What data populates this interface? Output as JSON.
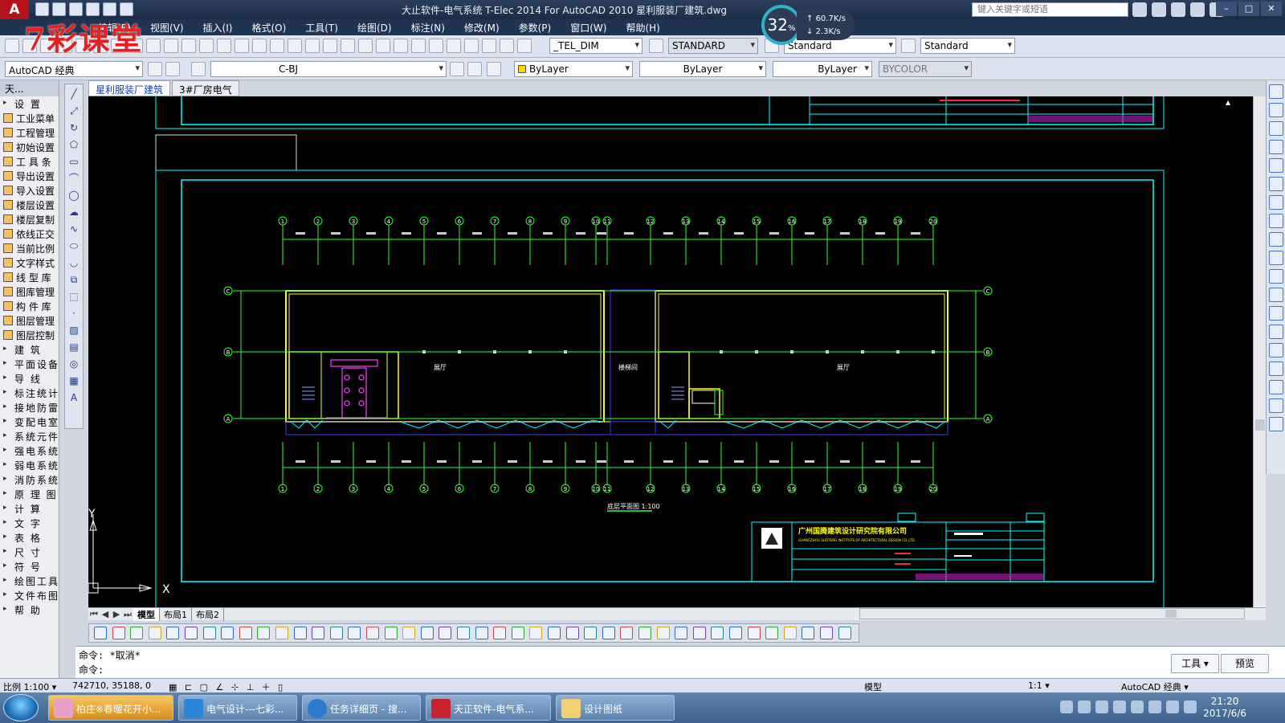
{
  "title_bar": {
    "title": "大止软件-电气系统 T-Elec 2014  For AutoCAD 2010    星利服装厂建筑.dwg",
    "search_placeholder": "键入关键字或短语",
    "app_logo": "A"
  },
  "watermark": "7彩课堂",
  "net_speed": {
    "percent": "32",
    "unit": "%",
    "up": "60.7K/s",
    "down": "2.3K/s"
  },
  "menu": [
    "编辑(E)",
    "视图(V)",
    "插入(I)",
    "格式(O)",
    "工具(T)",
    "绘图(D)",
    "标注(N)",
    "修改(M)",
    "参数(P)",
    "窗口(W)",
    "帮助(H)"
  ],
  "toolbar1": {
    "dim_style": "_TEL_DIM",
    "text_style": "STANDARD",
    "table_style": "Standard",
    "multileader_style": "Standard"
  },
  "toolbar2": {
    "workspace": "AutoCAD 经典",
    "layer": "C-BJ",
    "color": "ByLayer",
    "linetype": "ByLayer",
    "lineweight": "ByLayer",
    "plotstyle": "BYCOLOR"
  },
  "left_panel": {
    "title": "天...",
    "items": [
      {
        "label": "设    置",
        "section": true
      },
      {
        "label": "工业菜单",
        "section": false
      },
      {
        "label": "工程管理",
        "section": false
      },
      {
        "label": "初始设置",
        "section": false
      },
      {
        "label": "工 具 条",
        "section": false
      },
      {
        "label": "导出设置",
        "section": false
      },
      {
        "label": "导入设置",
        "section": false
      },
      {
        "label": "楼层设置",
        "section": false
      },
      {
        "label": "楼层复制",
        "section": false
      },
      {
        "label": "依线正交",
        "section": false
      },
      {
        "label": "当前比例",
        "section": false
      },
      {
        "label": "文字样式",
        "section": false
      },
      {
        "label": "线 型 库",
        "section": false
      },
      {
        "label": "图库管理",
        "section": false
      },
      {
        "label": "构 件 库",
        "section": false
      },
      {
        "label": "图层管理",
        "section": false
      },
      {
        "label": "图层控制",
        "section": false
      },
      {
        "label": "建    筑",
        "section": true
      },
      {
        "label": "平面设备",
        "section": true
      },
      {
        "label": "导    线",
        "section": true
      },
      {
        "label": "标注统计",
        "section": true
      },
      {
        "label": "接地防雷",
        "section": true
      },
      {
        "label": "变配电室",
        "section": true
      },
      {
        "label": "系统元件",
        "section": true
      },
      {
        "label": "强电系统",
        "section": true
      },
      {
        "label": "弱电系统",
        "section": true
      },
      {
        "label": "消防系统",
        "section": true
      },
      {
        "label": "原 理 图",
        "section": true
      },
      {
        "label": "计    算",
        "section": true
      },
      {
        "label": "文    字",
        "section": true
      },
      {
        "label": "表    格",
        "section": true
      },
      {
        "label": "尺    寸",
        "section": true
      },
      {
        "label": "符    号",
        "section": true
      },
      {
        "label": "绘图工具",
        "section": true
      },
      {
        "label": "文件布图",
        "section": true
      },
      {
        "label": "帮    助",
        "section": true
      }
    ]
  },
  "doc_tabs": [
    "星利服装厂建筑",
    "3#厂房电气"
  ],
  "drawing": {
    "plan_title": "底层平面图 1:100",
    "axis_top": [
      "1",
      "2",
      "3",
      "4",
      "5",
      "6",
      "7",
      "8",
      "9",
      "10",
      "11",
      "12",
      "13",
      "14",
      "15",
      "16",
      "17",
      "18",
      "19",
      "20"
    ],
    "axis_side": [
      "C",
      "B",
      "A"
    ],
    "company": "广州国腾建筑设计研究院有限公司",
    "company_en": "GUANGZHOU GUOTENG INSTITUTE OF ARCHITECTURAL DESIGN CO.,LTD.",
    "room_left": "展厅",
    "room_right": "展厅",
    "corridor": "楼梯间",
    "axis_y_label": "Y",
    "axis_x_label": "X"
  },
  "layout_tabs": [
    "模型",
    "布局1",
    "布局2"
  ],
  "command_lines": [
    "命令: *取消*",
    "命令:"
  ],
  "cmd_buttons": [
    "工具 ▾",
    "预览"
  ],
  "statusbar": {
    "scale": "比例 1:100 ▾",
    "coords": "742710, 35188, 0",
    "model": "模型",
    "anno_scale": "1:1 ▾",
    "workspace": "AutoCAD 经典 ▾"
  },
  "taskbar": {
    "tasks": [
      "柏庄※春暖花开小...",
      "电气设计---七彩...",
      "任务详细页 - 搜...",
      "天正软件-电气系...",
      "设计图纸"
    ],
    "time": "21:20",
    "date": "2017/6/6"
  }
}
